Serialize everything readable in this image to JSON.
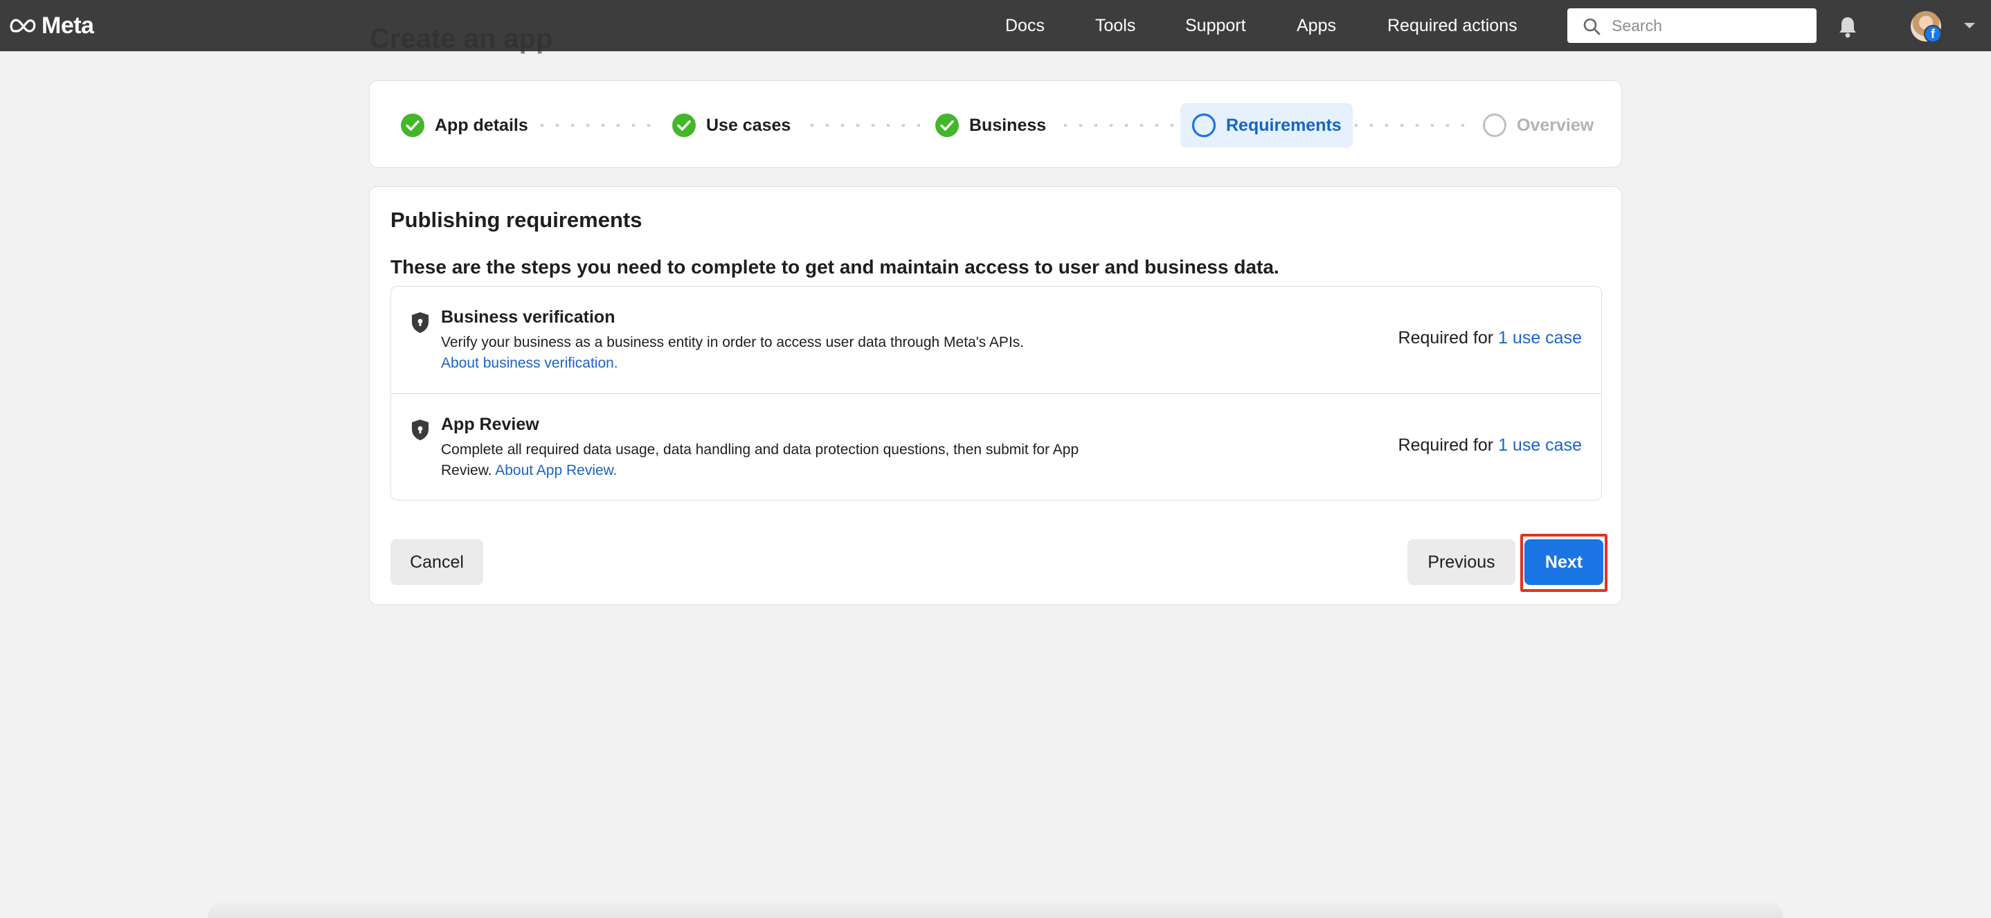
{
  "brand": {
    "name": "Meta"
  },
  "nav": {
    "links": [
      "Docs",
      "Tools",
      "Support",
      "Apps",
      "Required actions"
    ],
    "search_placeholder": "Search"
  },
  "page": {
    "background_title": "Create an app"
  },
  "stepper": {
    "steps": [
      {
        "label": "App details",
        "status": "complete"
      },
      {
        "label": "Use cases",
        "status": "complete"
      },
      {
        "label": "Business",
        "status": "complete"
      },
      {
        "label": "Requirements",
        "status": "current"
      },
      {
        "label": "Overview",
        "status": "upcoming"
      }
    ]
  },
  "main": {
    "title": "Publishing requirements",
    "subtitle": "These are the steps you need to complete to get and maintain access to user and business data.",
    "requirements": [
      {
        "title": "Business verification",
        "description": "Verify your business as a business entity in order to access user data through Meta's APIs.",
        "link": "About business verification.",
        "required_prefix": "Required for",
        "required_link": "1 use case"
      },
      {
        "title": "App Review",
        "description": "Complete all required data usage, data handling and data protection questions, then submit for App Review.",
        "link": "About App Review.",
        "required_prefix": "Required for",
        "required_link": "1 use case"
      }
    ],
    "buttons": {
      "cancel": "Cancel",
      "previous": "Previous",
      "next": "Next"
    }
  },
  "colors": {
    "nav_bg": "#3d3d3d",
    "check_green": "#42b72a",
    "accent_blue": "#1b74e4",
    "link_blue": "#1b63c8",
    "highlight_red": "#e0341e"
  },
  "icons": {
    "logo": "meta-infinity-icon",
    "search": "search-icon",
    "notifications": "bell-icon",
    "step_complete": "check-circle-icon",
    "step_current": "ring-icon",
    "requirement": "shield-icon",
    "account_menu": "caret-down-icon"
  }
}
